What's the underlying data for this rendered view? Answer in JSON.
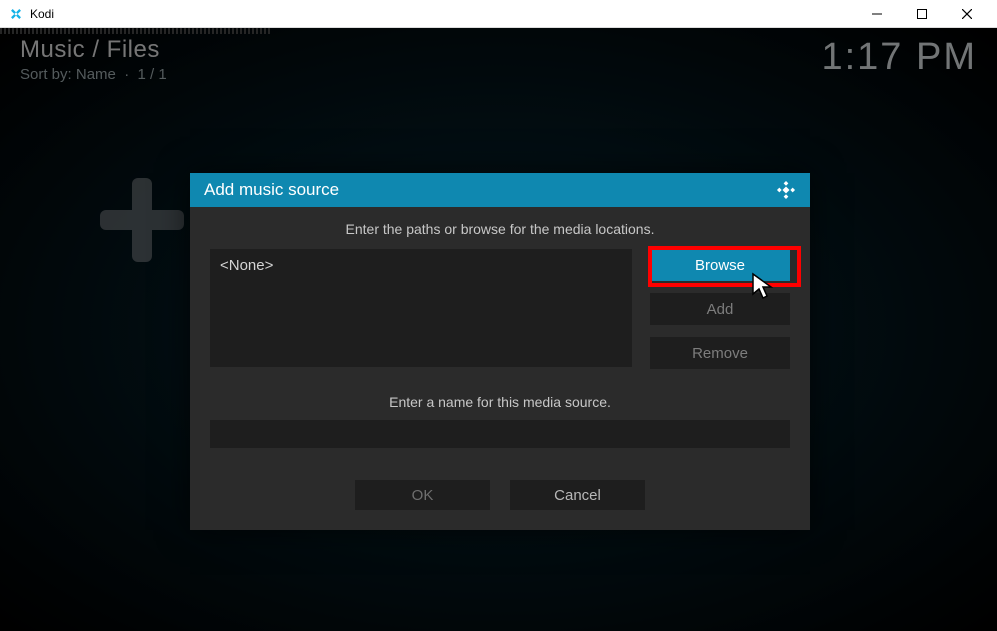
{
  "window": {
    "title": "Kodi"
  },
  "header": {
    "breadcrumb": "Music / Files",
    "sort_prefix": "Sort by:",
    "sort_value": "Name",
    "page_info": "1 / 1",
    "clock": "1:17 PM"
  },
  "dialog": {
    "title": "Add music source",
    "instruction": "Enter the paths or browse for the media locations.",
    "path_value": "<None>",
    "buttons": {
      "browse": "Browse",
      "add": "Add",
      "remove": "Remove"
    },
    "name_label": "Enter a name for this media source.",
    "name_value": "",
    "ok": "OK",
    "cancel": "Cancel"
  }
}
